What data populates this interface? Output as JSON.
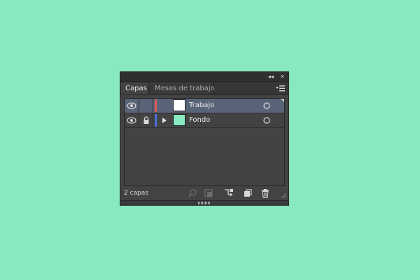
{
  "panel": {
    "tabs": [
      {
        "label": "Capas",
        "active": true
      },
      {
        "label": "Mesas de trabajo",
        "active": false
      }
    ],
    "controls": {
      "collapse_glyph": "◂◂",
      "close_glyph": "✕"
    },
    "layers": [
      {
        "name": "Trabajo",
        "visible": true,
        "locked": false,
        "expandable": false,
        "selected": true,
        "layer_color": "#e05a5a",
        "thumbnail_color": "#ffffff"
      },
      {
        "name": "Fondo",
        "visible": true,
        "locked": true,
        "expandable": true,
        "selected": false,
        "layer_color": "#4b6fd9",
        "thumbnail_color": "#88e8c0"
      }
    ],
    "footer": {
      "layer_count": "2 capas"
    }
  },
  "colors": {
    "background": "#88e8c0",
    "panel": "#434343",
    "selection": "#5a6478"
  },
  "icons": {
    "footer": [
      "locate-object-icon",
      "make-clipping-mask-icon",
      "create-sublayer-icon",
      "create-new-layer-icon",
      "delete-layer-icon"
    ]
  }
}
